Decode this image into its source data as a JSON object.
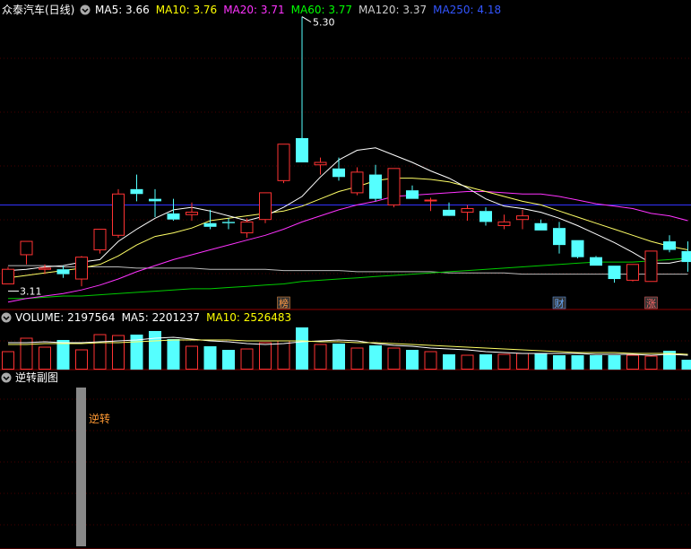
{
  "main": {
    "title": "众泰汽车(日线)",
    "ma_labels": [
      {
        "text": "MA5: 3.66",
        "color": "#ffffff"
      },
      {
        "text": "MA10: 3.76",
        "color": "#ffff00"
      },
      {
        "text": "MA20: 3.71",
        "color": "#ff33ff"
      },
      {
        "text": "MA60: 3.77",
        "color": "#00ff00"
      },
      {
        "text": "MA120: 3.37",
        "color": "#cccccc"
      },
      {
        "text": "MA250: 4.18",
        "color": "#3355ff"
      }
    ],
    "high_label": "5.30",
    "low_label": "3.11",
    "markers": [
      {
        "text": "榜",
        "index": 15,
        "color": "#ff9944"
      },
      {
        "text": "财",
        "index": 30,
        "color": "#66aaff"
      },
      {
        "text": "涨",
        "index": 35,
        "color": "#ff6666"
      }
    ]
  },
  "volume": {
    "labels": [
      {
        "text": "VOLUME: 2197564",
        "color": "#ffffff"
      },
      {
        "text": "MA5: 2201237",
        "color": "#ffffff"
      },
      {
        "text": "MA10: 2526483",
        "color": "#ffff00"
      }
    ]
  },
  "sub": {
    "title": "逆转副图",
    "signal_label": "逆转"
  },
  "colors": {
    "up": "#ff3333",
    "down": "#55ffff",
    "grid": "#8b0000",
    "ma5": "#ffffff",
    "ma10": "#ffff66",
    "ma20": "#ff33ff",
    "ma60": "#00cc00",
    "ma120": "#bbbbbb",
    "ma250": "#3333ff"
  },
  "chart_data": {
    "type": "candlestick",
    "ylim": [
      3.0,
      5.4
    ],
    "candles": [
      {
        "o": 3.1,
        "h": 3.24,
        "l": 3.1,
        "c": 3.22
      },
      {
        "o": 3.34,
        "h": 3.45,
        "l": 3.26,
        "c": 3.45
      },
      {
        "o": 3.22,
        "h": 3.26,
        "l": 3.18,
        "c": 3.23
      },
      {
        "o": 3.22,
        "h": 3.25,
        "l": 3.15,
        "c": 3.18
      },
      {
        "o": 3.14,
        "h": 3.33,
        "l": 3.08,
        "c": 3.32
      },
      {
        "o": 3.38,
        "h": 3.55,
        "l": 3.35,
        "c": 3.55
      },
      {
        "o": 3.5,
        "h": 3.88,
        "l": 3.48,
        "c": 3.84
      },
      {
        "o": 3.88,
        "h": 4.0,
        "l": 3.78,
        "c": 3.84
      },
      {
        "o": 3.8,
        "h": 3.88,
        "l": 3.65,
        "c": 3.78
      },
      {
        "o": 3.68,
        "h": 3.8,
        "l": 3.62,
        "c": 3.63
      },
      {
        "o": 3.67,
        "h": 3.77,
        "l": 3.62,
        "c": 3.69
      },
      {
        "o": 3.6,
        "h": 3.71,
        "l": 3.55,
        "c": 3.57
      },
      {
        "o": 3.61,
        "h": 3.64,
        "l": 3.55,
        "c": 3.6
      },
      {
        "o": 3.52,
        "h": 3.64,
        "l": 3.48,
        "c": 3.61
      },
      {
        "o": 3.63,
        "h": 3.85,
        "l": 3.6,
        "c": 3.85
      },
      {
        "o": 3.95,
        "h": 4.25,
        "l": 3.93,
        "c": 4.25
      },
      {
        "o": 4.3,
        "h": 5.3,
        "l": 4.15,
        "c": 4.1
      },
      {
        "o": 4.08,
        "h": 4.14,
        "l": 4.0,
        "c": 4.1
      },
      {
        "o": 4.05,
        "h": 4.14,
        "l": 3.95,
        "c": 3.98
      },
      {
        "o": 3.85,
        "h": 4.06,
        "l": 3.83,
        "c": 4.02
      },
      {
        "o": 4.0,
        "h": 4.08,
        "l": 3.78,
        "c": 3.8
      },
      {
        "o": 3.75,
        "h": 4.05,
        "l": 3.73,
        "c": 4.05
      },
      {
        "o": 3.87,
        "h": 3.91,
        "l": 3.8,
        "c": 3.8
      },
      {
        "o": 3.79,
        "h": 3.81,
        "l": 3.7,
        "c": 3.79
      },
      {
        "o": 3.71,
        "h": 3.77,
        "l": 3.67,
        "c": 3.66
      },
      {
        "o": 3.69,
        "h": 3.75,
        "l": 3.62,
        "c": 3.72
      },
      {
        "o": 3.7,
        "h": 3.73,
        "l": 3.58,
        "c": 3.61
      },
      {
        "o": 3.58,
        "h": 3.67,
        "l": 3.55,
        "c": 3.61
      },
      {
        "o": 3.63,
        "h": 3.71,
        "l": 3.55,
        "c": 3.66
      },
      {
        "o": 3.6,
        "h": 3.63,
        "l": 3.54,
        "c": 3.54
      },
      {
        "o": 3.56,
        "h": 3.61,
        "l": 3.35,
        "c": 3.42
      },
      {
        "o": 3.46,
        "h": 3.46,
        "l": 3.31,
        "c": 3.32
      },
      {
        "o": 3.32,
        "h": 3.33,
        "l": 3.25,
        "c": 3.25
      },
      {
        "o": 3.25,
        "h": 3.25,
        "l": 3.11,
        "c": 3.14
      },
      {
        "o": 3.13,
        "h": 3.26,
        "l": 3.12,
        "c": 3.26
      },
      {
        "o": 3.12,
        "h": 3.37,
        "l": 3.12,
        "c": 3.37
      },
      {
        "o": 3.45,
        "h": 3.5,
        "l": 3.36,
        "c": 3.38
      },
      {
        "o": 3.37,
        "h": 3.45,
        "l": 3.2,
        "c": 3.28
      }
    ],
    "ma5": [
      3.21,
      3.22,
      3.24,
      3.25,
      3.28,
      3.3,
      3.45,
      3.55,
      3.64,
      3.71,
      3.73,
      3.7,
      3.66,
      3.62,
      3.66,
      3.73,
      3.82,
      3.98,
      4.12,
      4.2,
      4.22,
      4.16,
      4.1,
      4.03,
      3.97,
      3.89,
      3.8,
      3.74,
      3.72,
      3.69,
      3.64,
      3.58,
      3.51,
      3.44,
      3.36,
      3.27,
      3.27,
      3.3
    ],
    "ma10": [
      3.15,
      3.17,
      3.19,
      3.21,
      3.23,
      3.26,
      3.33,
      3.42,
      3.49,
      3.52,
      3.56,
      3.62,
      3.64,
      3.66,
      3.68,
      3.7,
      3.74,
      3.8,
      3.86,
      3.9,
      3.95,
      3.97,
      3.97,
      3.96,
      3.94,
      3.9,
      3.86,
      3.82,
      3.78,
      3.75,
      3.7,
      3.65,
      3.6,
      3.55,
      3.5,
      3.45,
      3.41,
      3.38
    ],
    "ma20": [
      2.95,
      2.98,
      3.0,
      3.02,
      3.05,
      3.09,
      3.14,
      3.2,
      3.25,
      3.3,
      3.34,
      3.38,
      3.42,
      3.46,
      3.5,
      3.55,
      3.61,
      3.66,
      3.71,
      3.75,
      3.78,
      3.82,
      3.83,
      3.84,
      3.85,
      3.86,
      3.86,
      3.85,
      3.84,
      3.84,
      3.82,
      3.79,
      3.76,
      3.74,
      3.72,
      3.68,
      3.66,
      3.62
    ],
    "ma60": [
      2.98,
      2.98,
      2.99,
      3.0,
      3.0,
      3.01,
      3.02,
      3.03,
      3.04,
      3.05,
      3.06,
      3.06,
      3.07,
      3.08,
      3.09,
      3.1,
      3.12,
      3.13,
      3.14,
      3.15,
      3.16,
      3.17,
      3.18,
      3.19,
      3.2,
      3.21,
      3.22,
      3.23,
      3.24,
      3.25,
      3.26,
      3.27,
      3.28,
      3.28,
      3.28,
      3.29,
      3.3,
      3.31
    ],
    "ma120": [
      3.25,
      3.25,
      3.25,
      3.24,
      3.24,
      3.24,
      3.24,
      3.23,
      3.23,
      3.23,
      3.23,
      3.22,
      3.22,
      3.22,
      3.22,
      3.21,
      3.21,
      3.21,
      3.21,
      3.2,
      3.2,
      3.2,
      3.2,
      3.2,
      3.19,
      3.19,
      3.19,
      3.19,
      3.18,
      3.18,
      3.18,
      3.18,
      3.18,
      3.18,
      3.18,
      3.18,
      3.18,
      3.18
    ],
    "ma250": [
      3.75,
      3.75,
      3.75,
      3.75,
      3.75,
      3.75,
      3.75,
      3.75,
      3.75,
      3.75,
      3.75,
      3.75,
      3.75,
      3.75,
      3.75,
      3.75,
      3.75,
      3.75,
      3.75,
      3.75,
      3.75,
      3.75,
      3.75,
      3.75,
      3.75,
      3.75,
      3.75,
      3.75,
      3.75,
      3.75,
      3.75,
      3.75,
      3.75,
      3.75,
      3.75,
      3.75,
      3.75,
      3.75
    ],
    "volume_ylim": [
      0,
      5000000
    ],
    "volume": [
      2000000,
      3500000,
      2500000,
      3300000,
      2200000,
      3900000,
      3800000,
      3900000,
      4300000,
      3400000,
      2600000,
      2600000,
      2200000,
      2300000,
      3000000,
      3200000,
      4700000,
      2800000,
      2900000,
      2400000,
      2700000,
      2400000,
      2200000,
      2000000,
      1700000,
      1600000,
      1700000,
      1700000,
      1800000,
      1800000,
      1600000,
      1600000,
      1600000,
      1600000,
      1600000,
      1500000,
      2100000,
      1100000
    ],
    "vol_ma5": [
      3000000,
      3000000,
      3100000,
      3000000,
      3000000,
      3100000,
      3200000,
      3300000,
      3500000,
      3600000,
      3400000,
      3200000,
      3100000,
      2900000,
      2800000,
      2900000,
      3100000,
      3200000,
      3300000,
      3200000,
      2900000,
      2700000,
      2600000,
      2400000,
      2300000,
      2200000,
      2000000,
      1900000,
      1800000,
      1800000,
      1800000,
      1800000,
      1700000,
      1700000,
      1700000,
      1600000,
      1700000,
      1600000
    ],
    "vol_ma10": [
      2800000,
      2800000,
      2900000,
      2900000,
      2900000,
      3000000,
      3000000,
      3100000,
      3200000,
      3300000,
      3300000,
      3300000,
      3300000,
      3200000,
      3200000,
      3200000,
      3200000,
      3100000,
      3100000,
      3000000,
      3000000,
      2900000,
      2800000,
      2700000,
      2600000,
      2500000,
      2400000,
      2300000,
      2200000,
      2100000,
      2000000,
      1900000,
      1900000,
      1900000,
      1800000,
      1800000,
      1800000,
      1700000
    ]
  }
}
